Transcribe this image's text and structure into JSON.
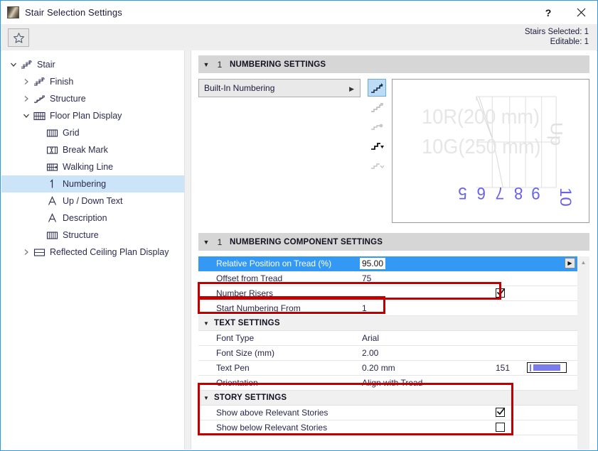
{
  "window": {
    "title": "Stair Selection Settings",
    "icon": "stair-app-icon",
    "help_label": "?",
    "close_label": "✕"
  },
  "toolbar": {
    "favorites_icon": "star-icon",
    "stairs_selected_label": "Stairs Selected: 1",
    "editable_label": "Editable: 1"
  },
  "tree": {
    "items": [
      {
        "label": "Stair",
        "icon": "stair-icon",
        "twisty": "expanded",
        "depth": 0,
        "selected": false
      },
      {
        "label": "Finish",
        "icon": "stair-finish-icon",
        "twisty": "collapsed",
        "depth": 1,
        "selected": false
      },
      {
        "label": "Structure",
        "icon": "stair-structure-icon",
        "twisty": "collapsed",
        "depth": 1,
        "selected": false
      },
      {
        "label": "Floor Plan Display",
        "icon": "floor-plan-icon",
        "twisty": "expanded",
        "depth": 1,
        "selected": false
      },
      {
        "label": "Grid",
        "icon": "grid-icon",
        "twisty": "none",
        "depth": 2,
        "selected": false
      },
      {
        "label": "Break Mark",
        "icon": "break-mark-icon",
        "twisty": "none",
        "depth": 2,
        "selected": false
      },
      {
        "label": "Walking Line",
        "icon": "walking-line-icon",
        "twisty": "none",
        "depth": 2,
        "selected": false
      },
      {
        "label": "Numbering",
        "icon": "numbering-icon",
        "twisty": "none",
        "depth": 2,
        "selected": true
      },
      {
        "label": "Up / Down Text",
        "icon": "text-a-icon",
        "twisty": "none",
        "depth": 2,
        "selected": false
      },
      {
        "label": "Description",
        "icon": "text-a-icon",
        "twisty": "none",
        "depth": 2,
        "selected": false
      },
      {
        "label": "Structure",
        "icon": "grid-icon",
        "twisty": "none",
        "depth": 2,
        "selected": false
      },
      {
        "label": "Reflected Ceiling Plan Display",
        "icon": "rcp-icon",
        "twisty": "collapsed",
        "depth": 1,
        "selected": false
      }
    ]
  },
  "numbering_settings": {
    "header_number": "1",
    "header_title": "NUMBERING SETTINGS",
    "combo_value": "Built-In Numbering",
    "view_modes": [
      {
        "name": "view-3d-shaded-icon",
        "active": true
      },
      {
        "name": "view-3d-wireframe-icon",
        "active": false
      },
      {
        "name": "view-3d-point-icon",
        "active": false
      },
      {
        "name": "view-section-icon",
        "active": false
      },
      {
        "name": "view-plan-icon",
        "active": false
      }
    ],
    "preview": {
      "riser_label": "10R(200 mm)",
      "going_label": "10G(250 mm)",
      "up_label": "Up",
      "tread_numbers": [
        "5",
        "6",
        "7",
        "8",
        "9",
        "10"
      ],
      "number_color": "#6a63e8",
      "ghost_color": "#e2e2e2"
    }
  },
  "component_settings": {
    "header_number": "1",
    "header_title": "NUMBERING COMPONENT SETTINGS",
    "rows": [
      {
        "label": "Relative Position on Tread (%)",
        "value": "95.00",
        "type": "number-selected",
        "selected": true,
        "spin": "▶"
      },
      {
        "label": "Offset from Tread",
        "value": "75",
        "type": "number",
        "selected": false
      },
      {
        "label": "Number Risers",
        "value": "",
        "type": "checkbox",
        "checked": true,
        "selected": false
      },
      {
        "label": "Start Numbering From",
        "value": "1",
        "type": "number",
        "selected": false
      }
    ],
    "groups": [
      {
        "title": "TEXT SETTINGS",
        "rows": [
          {
            "label": "Font Type",
            "value": "Arial",
            "type": "text"
          },
          {
            "label": "Font Size (mm)",
            "value": "2.00",
            "type": "text"
          },
          {
            "label": "Text Pen",
            "value": "0.20 mm",
            "pen_number": "151",
            "pen_color": "#7b7bee",
            "type": "pen"
          },
          {
            "label": "Orientation",
            "value": "Align with Tread",
            "type": "text"
          }
        ]
      },
      {
        "title": "STORY SETTINGS",
        "rows": [
          {
            "label": "Show above Relevant Stories",
            "value": "",
            "type": "checkbox",
            "checked": true
          },
          {
            "label": "Show below Relevant Stories",
            "value": "",
            "type": "checkbox",
            "checked": false
          }
        ]
      }
    ]
  },
  "annotations": {
    "highlight_color": "#c00000",
    "boxes": [
      {
        "name": "number-risers-highlight"
      },
      {
        "name": "start-numbering-from-highlight"
      },
      {
        "name": "story-settings-highlight"
      }
    ]
  },
  "colors": {
    "window_border": "#3399dd",
    "selected_row": "#3399f5",
    "tree_selection": "#cce4f7",
    "section_header": "#d6d6d6"
  }
}
